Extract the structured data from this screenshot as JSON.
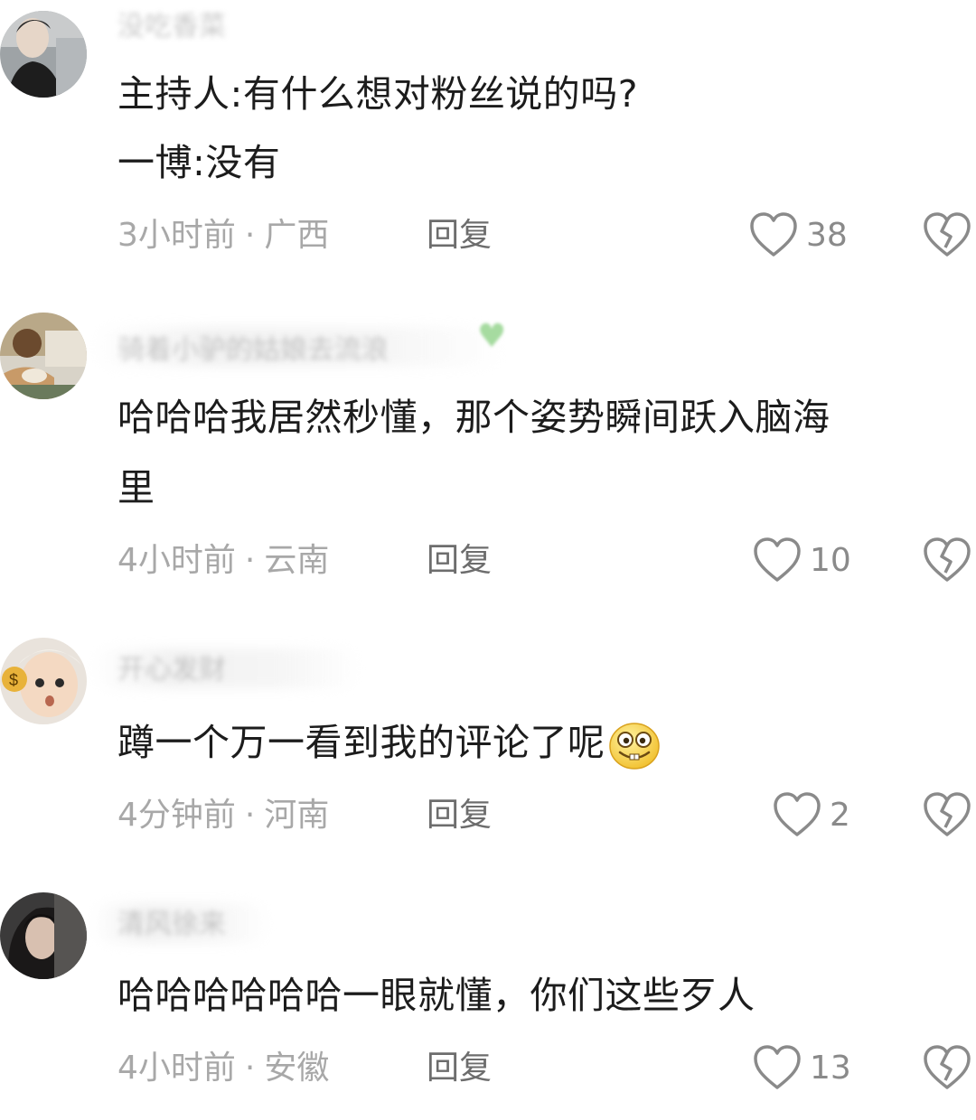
{
  "comments": [
    {
      "username": "没吃香菜",
      "lines": [
        "主持人:有什么想对粉丝说的吗?",
        "一博:没有"
      ],
      "time": "3小时前",
      "region": "广西",
      "reply_label": "回复",
      "likes": "38"
    },
    {
      "username": "骑着小驴的姑娘去流浪",
      "lines": [
        "哈哈哈我居然秒懂，那个姿势瞬间跃入脑海",
        "里"
      ],
      "time": "4小时前",
      "region": "云南",
      "reply_label": "回复",
      "likes": "10"
    },
    {
      "username": "开心发财",
      "lines": [
        "蹲一个万一看到我的评论了呢"
      ],
      "time": "4分钟前",
      "region": "河南",
      "reply_label": "回复",
      "likes": "2"
    },
    {
      "username": "清风徐来",
      "lines": [
        "哈哈哈哈哈哈一眼就懂，你们这些歹人"
      ],
      "time": "4小时前",
      "region": "安徽",
      "reply_label": "回复",
      "likes": "13"
    }
  ],
  "separator": "·",
  "icons": {
    "like": "heart-outline-icon",
    "dislike": "broken-heart-icon",
    "emoji": "grinning-emoji-icon"
  },
  "colors": {
    "text": "#1c1c1c",
    "meta": "#a8a8a8",
    "reply": "#6d6d6d",
    "icon": "#8a8a8a"
  }
}
